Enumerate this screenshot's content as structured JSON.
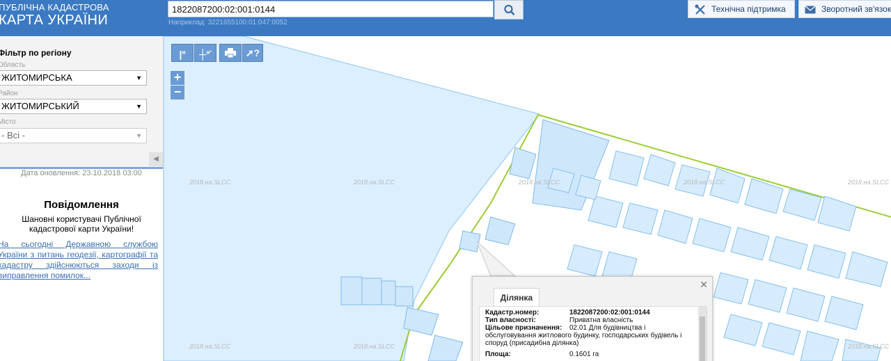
{
  "header": {
    "brand_line1": "ПУБЛІЧНА КАДАСТРОВА",
    "brand_line2": "КАРТА УКРАЇНИ",
    "search_value": "1822087200:02:001:0144",
    "search_hint": "Наприклад: 3221655100:01:047:0052",
    "support_label": "Технічна підтримка",
    "feedback_label": "Зворотний зв'язок"
  },
  "filter": {
    "title": "Фільтр по регіону",
    "region_label": "Область",
    "region_value": "ЖИТОМИРСЬКА",
    "district_label": "Район",
    "district_value": "ЖИТОМИРСЬКИЙ",
    "city_label": "Місто",
    "city_value": "- Всі -"
  },
  "sidebar": {
    "updated": "Дата оновлення: 23.10.2018 03:00",
    "notice_title": "Повідомлення",
    "notice_text": "Шановні користувачі Публічної кадастрової карти України!",
    "notice_link": "На сьогодні Державною службою України з питань геодезії, картографії та кадастру здійснюються заходи із виправлення помилок..."
  },
  "map": {
    "watermark": "2018.на.SLCC"
  },
  "popup": {
    "tab": "Ділянка",
    "rows": [
      {
        "key": "Кадастр.номер:",
        "value": "1822087200:02:001:0144"
      },
      {
        "key": "Тип власності:",
        "value": "Приватна власність"
      },
      {
        "key": "Цільове призначення:",
        "value": "02.01 Для будівництва і обслуговування житлового будинку, господарських будівель і споруд (присадибна ділянка)"
      },
      {
        "key": "Площа:",
        "value": "0.1601 га"
      }
    ]
  }
}
